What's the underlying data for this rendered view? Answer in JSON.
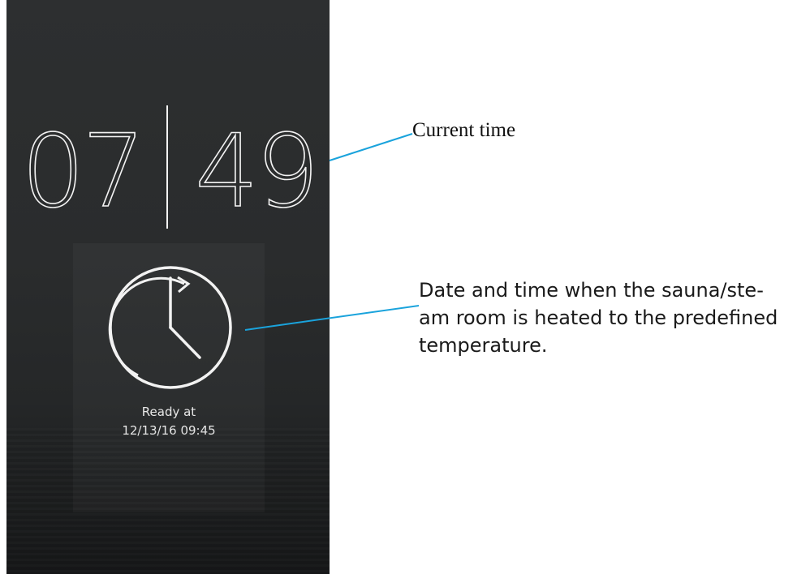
{
  "screen": {
    "time": {
      "hours": "07",
      "minutes": "49"
    },
    "ready": {
      "label": "Ready at",
      "datetime": "12/13/16 09:45",
      "icon": "schedule-clock-icon"
    }
  },
  "callouts": {
    "current_time": "Current time",
    "ready_lines": [
      "Date and time when the sauna/ste-",
      "am room is heated to the predefined",
      "temperature."
    ]
  },
  "colors": {
    "screen_background": "#2a2c2d",
    "display_text": "#f2f2f2",
    "callout_line": "#1aa3dc",
    "callout_text": "#111111"
  }
}
